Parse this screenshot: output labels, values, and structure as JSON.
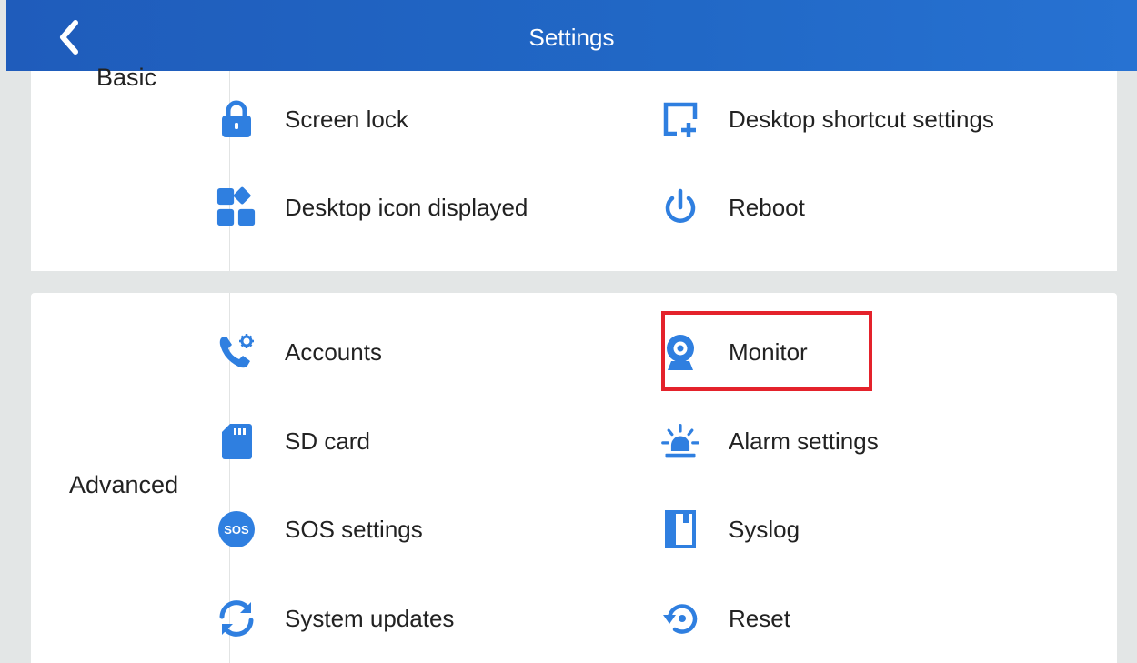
{
  "header": {
    "title": "Settings",
    "back_icon": "chevron-left-icon"
  },
  "accent_color": "#2f7fe0",
  "highlight_color": "#e4222b",
  "sections": {
    "basic": {
      "label": "Basic",
      "items": [
        {
          "label": "Screen lock",
          "icon": "lock-icon"
        },
        {
          "label": "Desktop shortcut settings",
          "icon": "add-shortcut-icon"
        },
        {
          "label": "Desktop icon displayed",
          "icon": "widgets-icon"
        },
        {
          "label": "Reboot",
          "icon": "power-icon"
        }
      ]
    },
    "advanced": {
      "label": "Advanced",
      "items": [
        {
          "label": "Accounts",
          "icon": "phone-settings-icon"
        },
        {
          "label": "Monitor",
          "icon": "webcam-icon",
          "highlighted": true
        },
        {
          "label": "SD card",
          "icon": "sd-card-icon"
        },
        {
          "label": "Alarm settings",
          "icon": "alarm-light-icon"
        },
        {
          "label": "SOS settings",
          "icon": "sos-icon",
          "badge": "SOS"
        },
        {
          "label": "Syslog",
          "icon": "log-icon"
        },
        {
          "label": "System updates",
          "icon": "sync-icon"
        },
        {
          "label": "Reset",
          "icon": "restore-icon"
        }
      ]
    }
  }
}
